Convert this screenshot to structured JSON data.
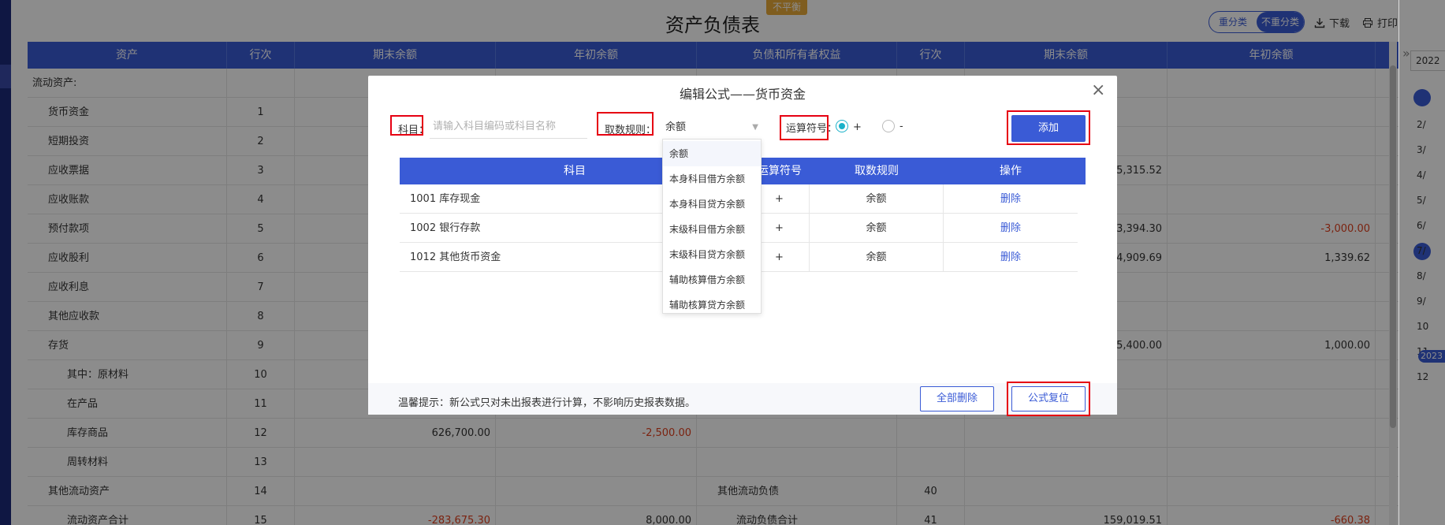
{
  "page": {
    "title": "资产负债表",
    "status_badge": "不平衡",
    "toggle": {
      "option_a": "重分类",
      "option_b": "不重分类"
    },
    "download_label": "下载",
    "print_label": "打印"
  },
  "sheet": {
    "headers": [
      "资产",
      "行次",
      "期末余额",
      "年初余额",
      "负债和所有者权益",
      "行次",
      "期末余额",
      "年初余额"
    ],
    "rows": [
      {
        "asset": "流动资产:",
        "line": "",
        "end": "",
        "begin": "",
        "liab": "",
        "lline": "",
        "lend": "",
        "lbegin": ""
      },
      {
        "asset": "货币资金",
        "line": "1",
        "end": "",
        "begin": "",
        "liab": "",
        "lline": "",
        "lend": "",
        "lbegin": ""
      },
      {
        "asset": "短期投资",
        "line": "2",
        "end": "",
        "begin": "",
        "liab": "",
        "lline": "",
        "lend": "",
        "lbegin": ""
      },
      {
        "asset": "应收票据",
        "line": "3",
        "end": "",
        "begin": "",
        "liab": "",
        "lline": "",
        "lend": "5,315.52",
        "lbegin": ""
      },
      {
        "asset": "应收账款",
        "line": "4",
        "end": "",
        "begin": "",
        "liab": "",
        "lline": "",
        "lend": "",
        "lbegin": ""
      },
      {
        "asset": "预付款项",
        "line": "5",
        "end": "",
        "begin": "",
        "liab": "",
        "lline": "",
        "lend": "23,394.30",
        "lbegin": "-3,000.00"
      },
      {
        "asset": "应收股利",
        "line": "6",
        "end": "",
        "begin": "",
        "liab": "",
        "lline": "",
        "lend": "4,909.69",
        "lbegin": "1,339.62"
      },
      {
        "asset": "应收利息",
        "line": "7",
        "end": "",
        "begin": "",
        "liab": "",
        "lline": "",
        "lend": "",
        "lbegin": ""
      },
      {
        "asset": "其他应收款",
        "line": "8",
        "end": "",
        "begin": "",
        "liab": "",
        "lline": "",
        "lend": "",
        "lbegin": ""
      },
      {
        "asset": "存货",
        "line": "9",
        "end": "",
        "begin": "",
        "liab": "",
        "lline": "",
        "lend": "125,400.00",
        "lbegin": "1,000.00"
      },
      {
        "asset": "其中：原材料",
        "line": "10",
        "end": "",
        "begin": "",
        "liab": "",
        "lline": "",
        "lend": "",
        "lbegin": ""
      },
      {
        "asset": "在产品",
        "line": "11",
        "end": "",
        "begin": "",
        "liab": "",
        "lline": "",
        "lend": "",
        "lbegin": ""
      },
      {
        "asset": "库存商品",
        "line": "12",
        "end": "626,700.00",
        "begin": "-2,500.00",
        "liab": "",
        "lline": "",
        "lend": "",
        "lbegin": ""
      },
      {
        "asset": "周转材料",
        "line": "13",
        "end": "",
        "begin": "",
        "liab": "",
        "lline": "",
        "lend": "",
        "lbegin": ""
      },
      {
        "asset": "其他流动资产",
        "line": "14",
        "end": "",
        "begin": "",
        "liab": "其他流动负债",
        "lline": "40",
        "lend": "",
        "lbegin": ""
      },
      {
        "asset": "流动资产合计",
        "line": "15",
        "end": "-283,675.30",
        "begin": "8,000.00",
        "liab": "流动负债合计",
        "lline": "41",
        "lend": "159,019.51",
        "lbegin": "-660.38"
      }
    ]
  },
  "right_panel": {
    "year": "2022",
    "months": [
      "",
      "2/",
      "3/",
      "4/",
      "5/",
      "6/",
      "7/",
      "8/",
      "9/",
      "10",
      "11",
      "12"
    ],
    "next_year": "2023"
  },
  "modal": {
    "title": "编辑公式——货币资金",
    "subject_label": "科目：",
    "subject_placeholder": "请输入科目编码或科目名称",
    "rule_label": "取数规则：",
    "rule_value": "余额",
    "operator_label": "运算符号：",
    "plus": "+",
    "minus": "-",
    "add_label": "添加",
    "table_headers": [
      "科目",
      "运算符号",
      "取数规则",
      "操作"
    ],
    "table_rows": [
      {
        "subject": "1001 库存现金",
        "op": "+",
        "rule": "余额",
        "action": "删除"
      },
      {
        "subject": "1002 银行存款",
        "op": "+",
        "rule": "余额",
        "action": "删除"
      },
      {
        "subject": "1012 其他货币资金",
        "op": "+",
        "rule": "余额",
        "action": "删除"
      }
    ],
    "dropdown_options": [
      "余额",
      "本身科目借方余额",
      "本身科目贷方余额",
      "末级科目借方余额",
      "末级科目贷方余额",
      "辅助核算借方余额",
      "辅助核算贷方余额"
    ],
    "tip": "温馨提示：新公式只对未出报表进行计算，不影响历史报表数据。",
    "delete_all_label": "全部删除",
    "reset_label": "公式复位"
  },
  "colors": {
    "primary": "#3a5bd6",
    "negative": "#e0401e",
    "highlight": "#e60012",
    "badge": "#e8a93a"
  }
}
